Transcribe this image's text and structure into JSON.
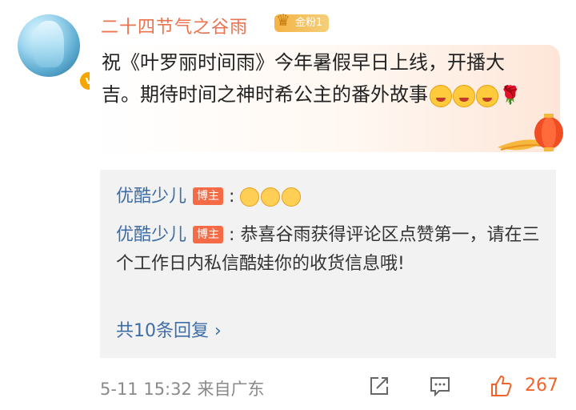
{
  "user": {
    "name": "二十四节气之谷雨",
    "fan_badge": "金粉1"
  },
  "post": {
    "text": "祝《叶罗丽时间雨》今年暑假早日上线，开播大吉。期待时间之神时希公主的番外故事"
  },
  "replies": [
    {
      "name": "优酷少儿",
      "badge": "博主",
      "sep": ":",
      "text": ""
    },
    {
      "name": "优酷少儿",
      "badge": "博主",
      "sep": ":",
      "text": "恭喜谷雨获得评论区点赞第一，请在三个工作日内私信酷娃你的收货信息哦!"
    }
  ],
  "more_replies": "共10条回复 ›",
  "footer": {
    "timestamp": "5-11 15:32",
    "location": "来自广东",
    "like_count": "267"
  },
  "colors": {
    "username": "#eb7350",
    "link": "#3e6ea5",
    "like": "#f0632b",
    "badge": "#f46b45"
  }
}
